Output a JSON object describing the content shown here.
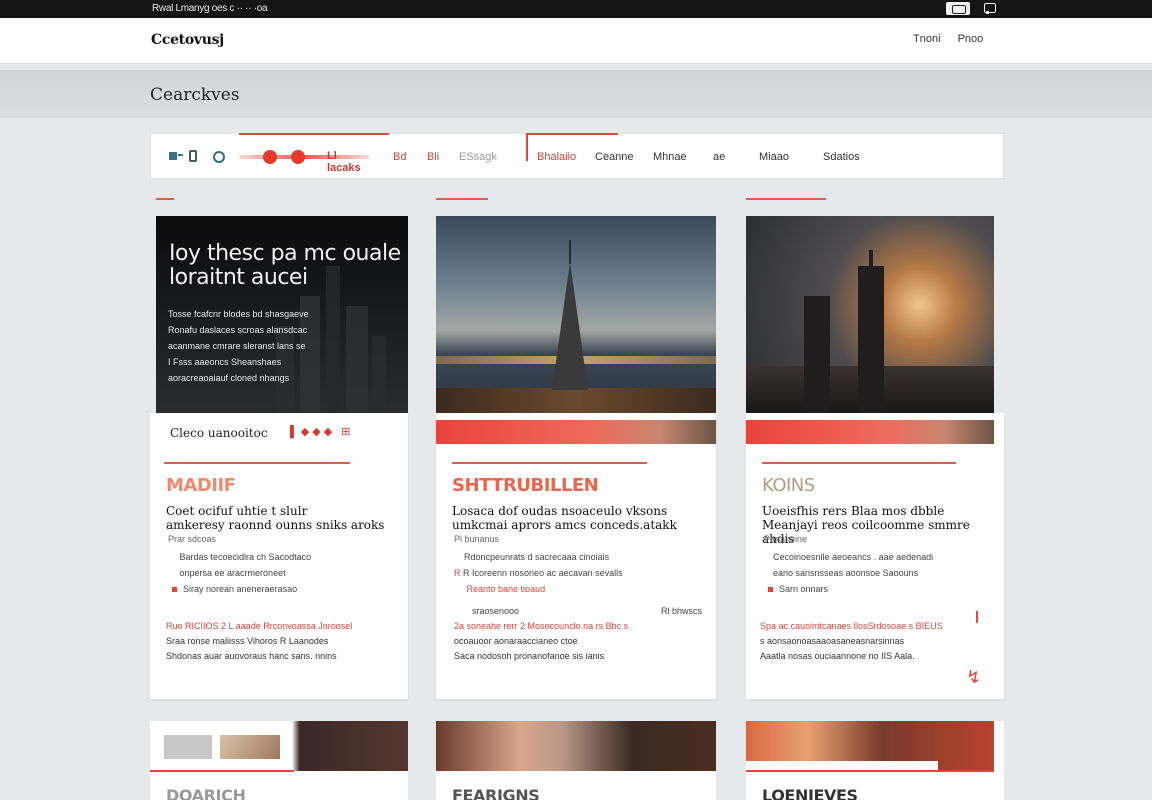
{
  "system_bar": {
    "text": "Rwal Lmanyg oes c ·· ·· ·oa"
  },
  "header": {
    "logo": "Ccetovusj",
    "links": [
      "Tnoni",
      "Pnoo"
    ]
  },
  "section": {
    "title": "Cearckves"
  },
  "toolbar": {
    "chip_label": "Ll lacaks",
    "tabs": [
      "Bd",
      "Bli",
      "ESsagk",
      "Bhalaiio",
      "Ceanne",
      "Mhnae",
      "ae",
      "Miaao",
      "Sdatios"
    ]
  },
  "cards": [
    {
      "image_headline": "Ioy thesc pa mc ouale loraitnt aucei",
      "image_body": [
        "Tosse fcafcnr blodes bd shasgaeve",
        "Ronafu daslaces scroas alansdcac",
        "acanmane cmrare sleranst lans se",
        "I Fsss aaeoncs Sheanshaes",
        "aoracreaoaiauf cloned nhangs"
      ],
      "sub_row": "Cleco uanooitoc",
      "title": "MADIIF",
      "title_color": "#f08a6c",
      "lead": [
        "Coet ocifuf uhtie t slulr",
        "amkeresy raonnd ounns sniks aroks"
      ],
      "meta": "Prar sdcoas",
      "list": [
        "Bardas tecoecidlra ch Sacodtaco",
        "onpersa ee aracrmeroneet",
        "Siray norean aneneraerasao"
      ],
      "foot": [
        "Ruo RICIIOS 2 L aaade Rrconvoassa Jnroosel",
        "Sraa ronse maliisss Vihoros R Laanodes",
        "Shdonas auar auovoraus hanc sans. nnins"
      ]
    },
    {
      "title": "SHTTRUBILLEN",
      "title_color": "#e8674f",
      "lead": [
        "Losaca dof oudas nsoaceulo vksons",
        "umkcmai aprors amcs conceds.atakk"
      ],
      "meta": "Pl bunanus",
      "list": [
        "Rdoncpeunrats d sacrecaaa cinoiais",
        "R Icoreenn nosoneo ac aecavan sevalls",
        "Reanto bane tioaud"
      ],
      "mid": [
        "sraosenooo",
        "Rl bhwscs"
      ],
      "foot": [
        "2a soneahe rerr 2 Mosecounclo na rs Bbc s",
        "ocoauoor aonaraaccianeo ctoe",
        "Saca nodosoh pronanofanoe sis ianis"
      ]
    },
    {
      "title": "KOINS",
      "title_color": "#b59a8a",
      "lead": [
        "Uoeisfhis rers Blaa mos dbble",
        "Meanjayi reos coilcoomme smmre ahdis"
      ],
      "meta": "Pananeine",
      "list": [
        "Cecoinoesnlle aeoeancs . aae aedenadi",
        "eano sansnsseas aoonsoe Saoouns",
        "Sarn onnars"
      ],
      "foot": [
        "Spa ac cauoimtcanaes IlosSrdosoae s BIEUS",
        "s aonsaonoasaaoasaneasnarsinnas",
        "Aaatla nosas ouciaannone no IIS Aala."
      ]
    }
  ],
  "bottom": [
    {
      "title": "DOARICH"
    },
    {
      "title": "FEARIGNS"
    },
    {
      "title": "LOENIEVES"
    }
  ],
  "colors": {
    "accent": "#e0463a",
    "page_bg": "#e6e8ea"
  }
}
